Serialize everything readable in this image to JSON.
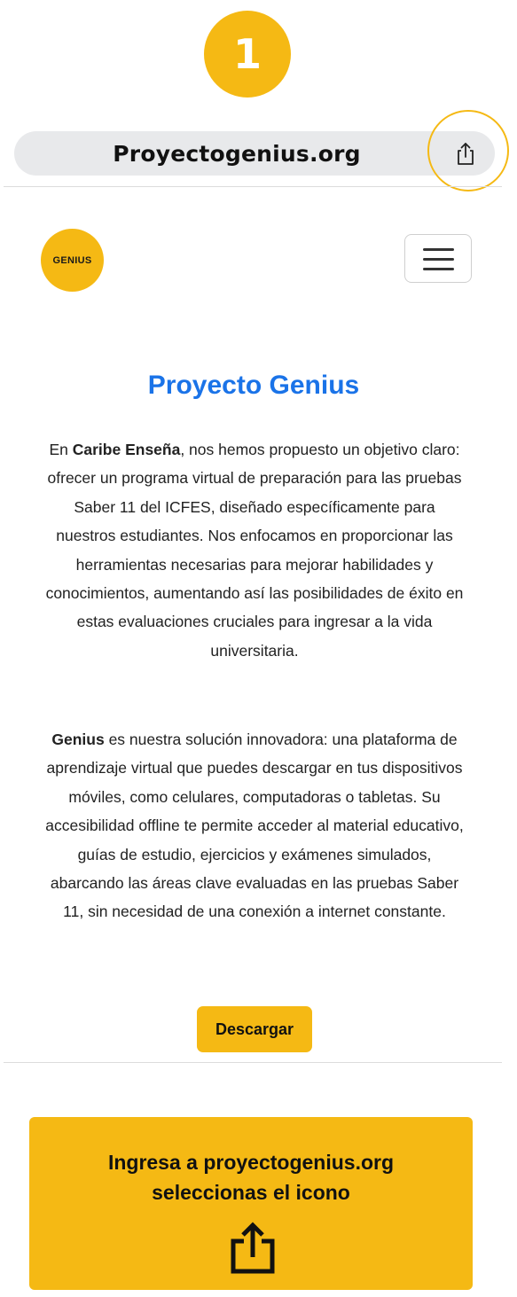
{
  "step": {
    "number": "1"
  },
  "browser": {
    "url": "Proyectogenius.org",
    "share_icon": "share-icon"
  },
  "site": {
    "logo_text": "GENIUS",
    "menu_icon": "hamburger-menu-icon",
    "title": "Proyecto Genius",
    "paragraph1": {
      "prefix": "En ",
      "bold": "Caribe Enseña",
      "text": ", nos hemos propuesto un objetivo claro: ofrecer un programa virtual de preparación para las pruebas Saber 11 del ICFES, diseñado específicamente para nuestros estudiantes. Nos enfocamos en proporcionar las herramientas necesarias para mejorar habilidades y conocimientos, aumentando así las posibilidades de éxito en estas evaluaciones cruciales para ingresar a la vida universitaria."
    },
    "paragraph2": {
      "bold": "Genius",
      "text": " es nuestra solución innovadora: una plataforma de aprendizaje virtual que puedes descargar en tus dispositivos móviles, como celulares, computadoras o tabletas. Su accesibilidad offline te permite acceder al material educativo, guías de estudio, ejercicios y exámenes simulados, abarcando las áreas clave evaluadas en las pruebas Saber 11, sin necesidad de una conexión a internet constante."
    },
    "download_label": "Descargar"
  },
  "instruction": {
    "line1": "Ingresa a proyectogenius.org",
    "line2": "seleccionas el icono",
    "icon": "share-icon"
  },
  "colors": {
    "accent": "#f5b914",
    "title_blue": "#1a73e8",
    "url_bar": "#e8e9eb"
  }
}
